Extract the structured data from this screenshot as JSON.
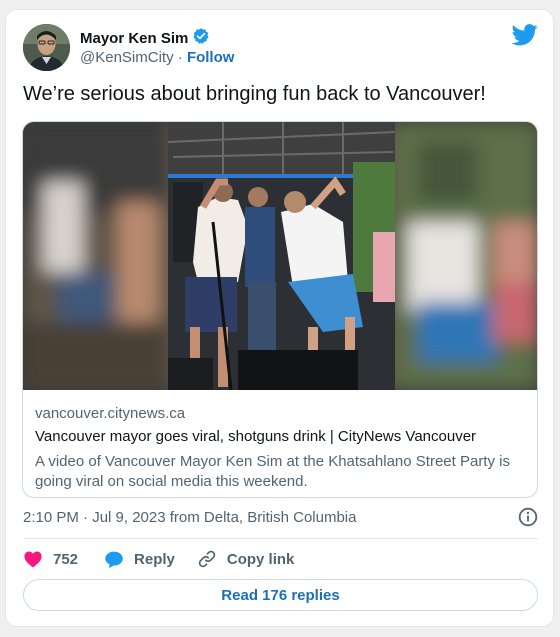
{
  "author": {
    "name": "Mayor Ken Sim",
    "handle": "@KenSimCity",
    "separator": " · ",
    "follow_label": "Follow",
    "verified": true
  },
  "tweet": {
    "text": "We’re serious about bringing fun back to Vancouver!"
  },
  "link_card": {
    "domain": "vancouver.citynews.ca",
    "title": "Vancouver mayor goes viral, shotguns drink | CityNews Vancouver",
    "description": "A video of Vancouver Mayor Ken Sim at the Khatsahlano Street Party is going viral on social media this weekend."
  },
  "meta": {
    "timestamp": "2:10 PM · Jul 9, 2023 from Delta, British Columbia"
  },
  "actions": {
    "like_count": "752",
    "reply_label": "Reply",
    "copy_label": "Copy link"
  },
  "footer": {
    "read_replies": "Read 176 replies"
  },
  "colors": {
    "accent": "#1d9bf0",
    "link": "#1d6fb8",
    "like": "#f91880",
    "text": "#0f1419",
    "muted": "#536471"
  },
  "icons": {
    "verified": "verified-badge-icon",
    "bird": "twitter-bird-icon",
    "info": "info-icon",
    "like": "heart-icon",
    "reply": "speech-bubble-icon",
    "copy": "link-icon"
  }
}
